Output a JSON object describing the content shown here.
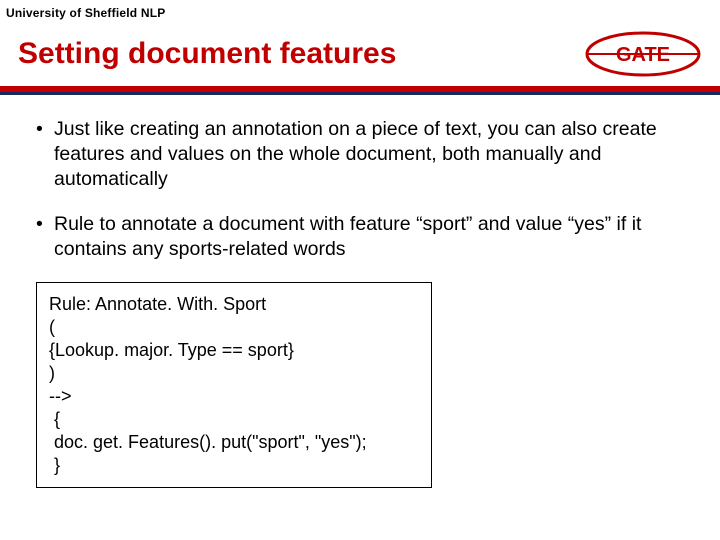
{
  "header": {
    "org": "University of Sheffield NLP"
  },
  "title": "Setting document features",
  "logo": {
    "text": "GATE",
    "border_color": "#c00000",
    "text_color": "#c00000"
  },
  "bars": {
    "red": "#c00000",
    "navy": "#1a2a5a"
  },
  "bullets": [
    "Just like creating an annotation on a piece of text, you can also create features and values on the whole document, both manually and automatically",
    "Rule to annotate a document with feature “sport” and value “yes” if it contains any sports-related words"
  ],
  "code": {
    "lines": [
      "Rule: Annotate. With. Sport",
      "(",
      "{Lookup. major. Type == sport}",
      ")",
      "-->",
      " {",
      " doc. get. Features(). put(\"sport\", \"yes\");",
      " }"
    ]
  }
}
